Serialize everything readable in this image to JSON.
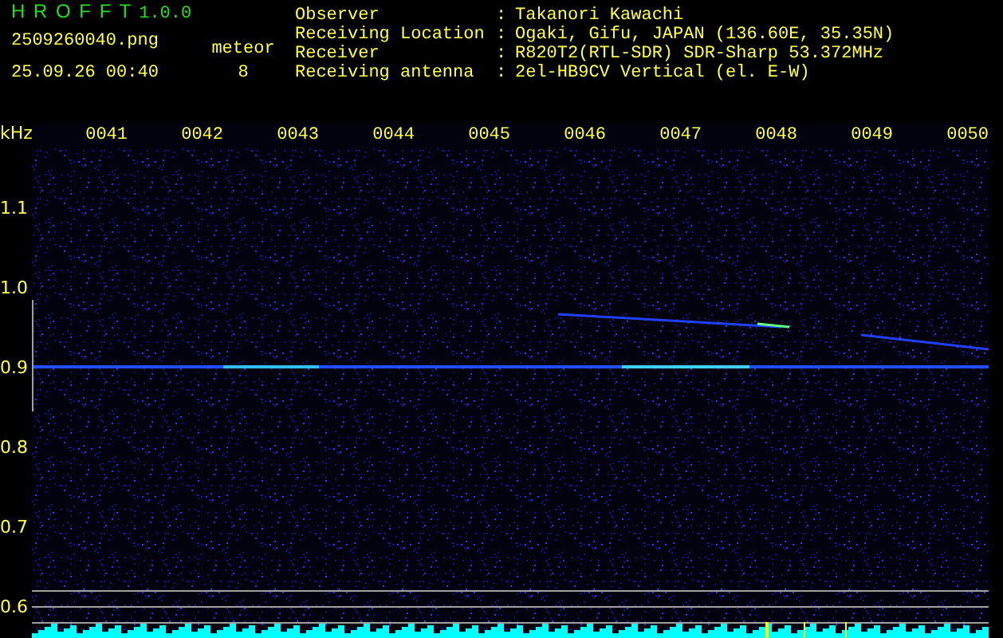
{
  "app": {
    "title": "H R O F F T",
    "version": "1.0.0",
    "file_name": "2509260040.png",
    "timestamp": "25.09.26 00:40"
  },
  "detection": {
    "label": "meteor",
    "count": "8"
  },
  "station_info": [
    {
      "label": "Observer",
      "separator": ":",
      "value": "Takanori Kawachi"
    },
    {
      "label": "Receiving Location",
      "separator": ":",
      "value": "Ogaki, Gifu, JAPAN (136.60E, 35.35N)"
    },
    {
      "label": "Receiver",
      "separator": ":",
      "value": "R820T2(RTL-SDR) SDR-Sharp 53.372MHz"
    },
    {
      "label": "Receiving antenna",
      "separator": ":",
      "value": "2el-HB9CV Vertical (el. E-W)"
    }
  ],
  "plot": {
    "frequency_unit": "kHz",
    "time_labels": [
      "0041",
      "0042",
      "0043",
      "0044",
      "0045",
      "0046",
      "0047",
      "0048",
      "0049",
      "0050"
    ],
    "frequency_labels": [
      "1.1",
      "1.0",
      "0.9",
      "0.8",
      "0.7",
      "0.6"
    ]
  }
}
